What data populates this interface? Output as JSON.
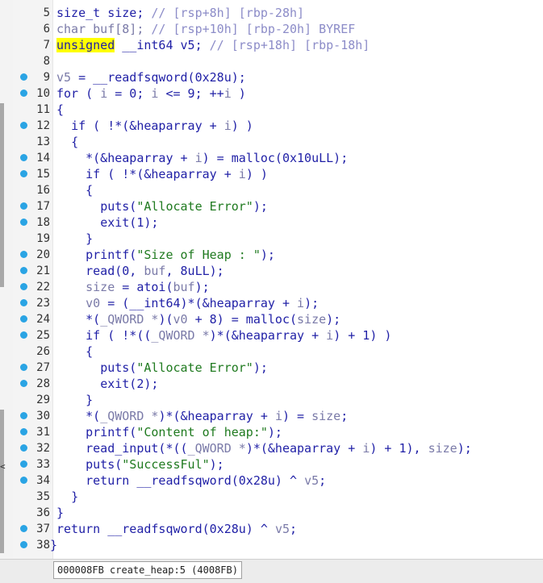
{
  "code_lines": [
    {
      "num": "5",
      "dot": false,
      "indent": "",
      "tokens": [
        {
          "t": "size_t size; ",
          "c": "kw"
        },
        {
          "t": "// [rsp+8h] [rbp-28h]",
          "c": "cm"
        }
      ]
    },
    {
      "num": "6",
      "dot": false,
      "indent": "",
      "tokens": [
        {
          "t": "char buf[8]; ",
          "c": "var"
        },
        {
          "t": "// [rsp+10h] [rbp-20h] BYREF",
          "c": "cm"
        }
      ]
    },
    {
      "num": "7",
      "dot": false,
      "indent": "",
      "tokens": [
        {
          "t": "unsigned",
          "c": "hl"
        },
        {
          "t": " __int64 v5; ",
          "c": "kw"
        },
        {
          "t": "// [rsp+18h] [rbp-18h]",
          "c": "cm"
        }
      ]
    },
    {
      "num": "8",
      "dot": false,
      "indent": "",
      "tokens": []
    },
    {
      "num": "9",
      "dot": true,
      "indent": "",
      "tokens": [
        {
          "t": "v5",
          "c": "var"
        },
        {
          "t": " = __readfsqword(0x28u);",
          "c": "kw"
        }
      ]
    },
    {
      "num": "10",
      "dot": true,
      "indent": "",
      "tokens": [
        {
          "t": "for ( ",
          "c": "kw"
        },
        {
          "t": "i",
          "c": "var"
        },
        {
          "t": " = 0; ",
          "c": "kw"
        },
        {
          "t": "i",
          "c": "var"
        },
        {
          "t": " <= 9; ++",
          "c": "kw"
        },
        {
          "t": "i",
          "c": "var"
        },
        {
          "t": " )",
          "c": "kw"
        }
      ]
    },
    {
      "num": "11",
      "dot": false,
      "indent": "",
      "tokens": [
        {
          "t": "{",
          "c": "kw"
        }
      ]
    },
    {
      "num": "12",
      "dot": true,
      "indent": "  ",
      "tokens": [
        {
          "t": "if ( !*(&heaparray + ",
          "c": "kw"
        },
        {
          "t": "i",
          "c": "var"
        },
        {
          "t": ") )",
          "c": "kw"
        }
      ]
    },
    {
      "num": "13",
      "dot": false,
      "indent": "  ",
      "tokens": [
        {
          "t": "{",
          "c": "kw"
        }
      ]
    },
    {
      "num": "14",
      "dot": true,
      "indent": "    ",
      "tokens": [
        {
          "t": "*(&heaparray + ",
          "c": "kw"
        },
        {
          "t": "i",
          "c": "var"
        },
        {
          "t": ") = malloc(0x10uLL);",
          "c": "kw"
        }
      ]
    },
    {
      "num": "15",
      "dot": true,
      "indent": "    ",
      "tokens": [
        {
          "t": "if ( !*(&heaparray + ",
          "c": "kw"
        },
        {
          "t": "i",
          "c": "var"
        },
        {
          "t": ") )",
          "c": "kw"
        }
      ]
    },
    {
      "num": "16",
      "dot": false,
      "indent": "    ",
      "tokens": [
        {
          "t": "{",
          "c": "kw"
        }
      ]
    },
    {
      "num": "17",
      "dot": true,
      "indent": "      ",
      "tokens": [
        {
          "t": "puts(",
          "c": "kw"
        },
        {
          "t": "\"Allocate Error\"",
          "c": "str"
        },
        {
          "t": ");",
          "c": "kw"
        }
      ]
    },
    {
      "num": "18",
      "dot": true,
      "indent": "      ",
      "tokens": [
        {
          "t": "exit(1);",
          "c": "kw"
        }
      ]
    },
    {
      "num": "19",
      "dot": false,
      "indent": "    ",
      "tokens": [
        {
          "t": "}",
          "c": "kw"
        }
      ]
    },
    {
      "num": "20",
      "dot": true,
      "indent": "    ",
      "tokens": [
        {
          "t": "printf(",
          "c": "kw"
        },
        {
          "t": "\"Size of Heap : \"",
          "c": "str"
        },
        {
          "t": ");",
          "c": "kw"
        }
      ]
    },
    {
      "num": "21",
      "dot": true,
      "indent": "    ",
      "tokens": [
        {
          "t": "read(0, ",
          "c": "kw"
        },
        {
          "t": "buf",
          "c": "var"
        },
        {
          "t": ", 8uLL);",
          "c": "kw"
        }
      ]
    },
    {
      "num": "22",
      "dot": true,
      "indent": "    ",
      "tokens": [
        {
          "t": "size",
          "c": "var"
        },
        {
          "t": " = atoi(",
          "c": "kw"
        },
        {
          "t": "buf",
          "c": "var"
        },
        {
          "t": ");",
          "c": "kw"
        }
      ]
    },
    {
      "num": "23",
      "dot": true,
      "indent": "    ",
      "tokens": [
        {
          "t": "v0",
          "c": "var"
        },
        {
          "t": " = (__int64)*(&heaparray + ",
          "c": "kw"
        },
        {
          "t": "i",
          "c": "var"
        },
        {
          "t": ");",
          "c": "kw"
        }
      ]
    },
    {
      "num": "24",
      "dot": true,
      "indent": "    ",
      "tokens": [
        {
          "t": "*(",
          "c": "kw"
        },
        {
          "t": "_QWORD *",
          "c": "var"
        },
        {
          "t": ")(",
          "c": "kw"
        },
        {
          "t": "v0",
          "c": "var"
        },
        {
          "t": " + 8) = malloc(",
          "c": "kw"
        },
        {
          "t": "size",
          "c": "var"
        },
        {
          "t": ");",
          "c": "kw"
        }
      ]
    },
    {
      "num": "25",
      "dot": true,
      "indent": "    ",
      "tokens": [
        {
          "t": "if ( !*((",
          "c": "kw"
        },
        {
          "t": "_QWORD *",
          "c": "var"
        },
        {
          "t": ")*(&heaparray + ",
          "c": "kw"
        },
        {
          "t": "i",
          "c": "var"
        },
        {
          "t": ") + 1) )",
          "c": "kw"
        }
      ]
    },
    {
      "num": "26",
      "dot": false,
      "indent": "    ",
      "tokens": [
        {
          "t": "{",
          "c": "kw"
        }
      ]
    },
    {
      "num": "27",
      "dot": true,
      "indent": "      ",
      "tokens": [
        {
          "t": "puts(",
          "c": "kw"
        },
        {
          "t": "\"Allocate Error\"",
          "c": "str"
        },
        {
          "t": ");",
          "c": "kw"
        }
      ]
    },
    {
      "num": "28",
      "dot": true,
      "indent": "      ",
      "tokens": [
        {
          "t": "exit(2);",
          "c": "kw"
        }
      ]
    },
    {
      "num": "29",
      "dot": false,
      "indent": "    ",
      "tokens": [
        {
          "t": "}",
          "c": "kw"
        }
      ]
    },
    {
      "num": "30",
      "dot": true,
      "indent": "    ",
      "tokens": [
        {
          "t": "*(",
          "c": "kw"
        },
        {
          "t": "_QWORD *",
          "c": "var"
        },
        {
          "t": ")*(&heaparray + ",
          "c": "kw"
        },
        {
          "t": "i",
          "c": "var"
        },
        {
          "t": ") = ",
          "c": "kw"
        },
        {
          "t": "size",
          "c": "var"
        },
        {
          "t": ";",
          "c": "kw"
        }
      ]
    },
    {
      "num": "31",
      "dot": true,
      "indent": "    ",
      "tokens": [
        {
          "t": "printf(",
          "c": "kw"
        },
        {
          "t": "\"Content of heap:\"",
          "c": "str"
        },
        {
          "t": ");",
          "c": "kw"
        }
      ]
    },
    {
      "num": "32",
      "dot": true,
      "indent": "    ",
      "tokens": [
        {
          "t": "read_input(*((",
          "c": "kw"
        },
        {
          "t": "_QWORD *",
          "c": "var"
        },
        {
          "t": ")*(&heaparray + ",
          "c": "kw"
        },
        {
          "t": "i",
          "c": "var"
        },
        {
          "t": ") + 1), ",
          "c": "kw"
        },
        {
          "t": "size",
          "c": "var"
        },
        {
          "t": ");",
          "c": "kw"
        }
      ]
    },
    {
      "num": "33",
      "dot": true,
      "indent": "    ",
      "tokens": [
        {
          "t": "puts(",
          "c": "kw"
        },
        {
          "t": "\"SuccessFul\"",
          "c": "str"
        },
        {
          "t": ");",
          "c": "kw"
        }
      ]
    },
    {
      "num": "34",
      "dot": true,
      "indent": "    ",
      "tokens": [
        {
          "t": "return __readfsqword(0x28u) ^ ",
          "c": "kw"
        },
        {
          "t": "v5",
          "c": "var"
        },
        {
          "t": ";",
          "c": "kw"
        }
      ]
    },
    {
      "num": "35",
      "dot": false,
      "indent": "  ",
      "tokens": [
        {
          "t": "}",
          "c": "kw"
        }
      ]
    },
    {
      "num": "36",
      "dot": false,
      "indent": "",
      "tokens": [
        {
          "t": "}",
          "c": "kw"
        }
      ]
    },
    {
      "num": "37",
      "dot": true,
      "indent": "",
      "tokens": [
        {
          "t": "return __readfsqword(0x28u) ^ ",
          "c": "kw"
        },
        {
          "t": "v5",
          "c": "var"
        },
        {
          "t": ";",
          "c": "kw"
        }
      ]
    },
    {
      "num": "38",
      "dot": true,
      "indent": "",
      "tokens": [
        {
          "t": "}",
          "c": "kw"
        }
      ],
      "outdent": true
    }
  ],
  "status": {
    "location": "000008FB create_heap:5 (4008FB)"
  },
  "left_strip_glyph": "<",
  "colors": {
    "keyword": "#1f1fa6",
    "comment": "#8c8cc8",
    "variable": "#7a7aa8",
    "string": "#1f7a1f",
    "highlight": "#ffff00",
    "breakpoint_dot": "#2aa4e4"
  },
  "icons": {
    "breakpoint_marker": "breakpoint-dot-icon"
  }
}
